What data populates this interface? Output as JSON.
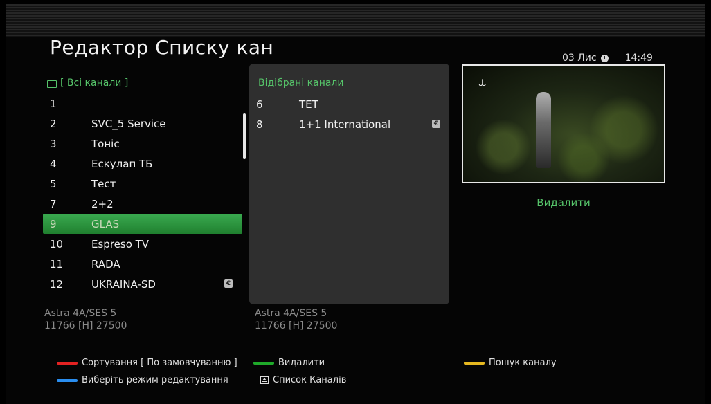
{
  "header": {
    "title": "Редактор Списку кан",
    "date": "03 Лис",
    "time": "14:49"
  },
  "left_list": {
    "header": "[ Всі канали ]",
    "rows": [
      {
        "num": "1",
        "name": ""
      },
      {
        "num": "2",
        "name": "SVC_5 Service"
      },
      {
        "num": "3",
        "name": "Тоніс"
      },
      {
        "num": "4",
        "name": "Ескулап ТБ"
      },
      {
        "num": "5",
        "name": "Тест"
      },
      {
        "num": "7",
        "name": "2+2"
      },
      {
        "num": "9",
        "name": "GLAS",
        "selected": true
      },
      {
        "num": "10",
        "name": "Espreso TV"
      },
      {
        "num": "11",
        "name": "RADA"
      },
      {
        "num": "12",
        "name": "UKRAINA-SD",
        "encrypted": true
      }
    ],
    "sat_name": "Astra 4A/SES 5",
    "sat_freq": "11766 [H] 27500"
  },
  "selected_list": {
    "header": "Відібрані канали",
    "rows": [
      {
        "num": "6",
        "name": "ТЕТ"
      },
      {
        "num": "8",
        "name": "1+1 International",
        "encrypted": true
      }
    ],
    "sat_name": "Astra 4A/SES 5",
    "sat_freq": "11766 [H] 27500"
  },
  "preview": {
    "action_label": "Видалити"
  },
  "legend": {
    "red": "Сортування [ По замовчуванню ]",
    "green": "Видалити",
    "yellow": "Пошук каналу",
    "blue": "Виберіть режим редактування",
    "eject": "Список Каналів"
  },
  "colors": {
    "accent_green": "#56c46a",
    "selection_green": "#2f9a42",
    "red_key": "#e32222",
    "green_key": "#1faa2a",
    "yellow_key": "#e6b820",
    "blue_key": "#2a8ef0"
  },
  "icons": {
    "encrypted": "e-icon",
    "clock": "clock-icon",
    "tv": "tv-icon",
    "eject": "eject-icon"
  }
}
